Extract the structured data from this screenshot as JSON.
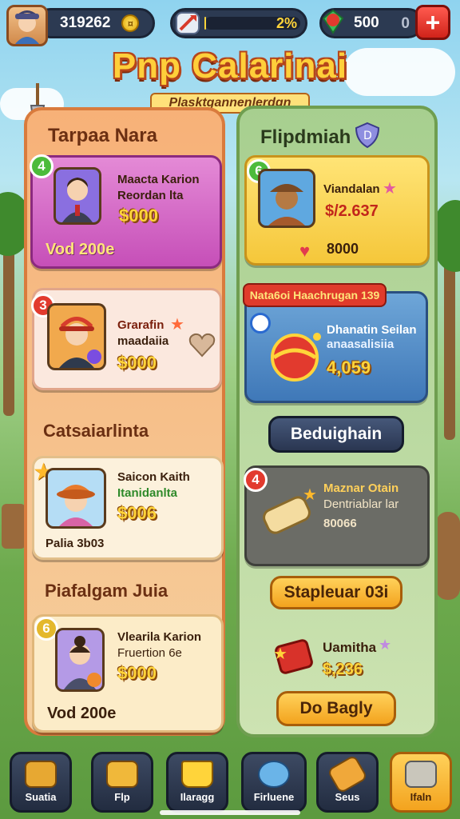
{
  "header": {
    "player_score": "319262",
    "progress_label": "2%",
    "gems": "500",
    "gems_side": "0"
  },
  "title": {
    "main": "Pnp Calarinai",
    "subtitle": "Plasktgannenlerdgn"
  },
  "left_panel": {
    "heading": "Tarpaa Nara",
    "cards": [
      {
        "badge": "4",
        "line1": "Maacta Karion",
        "line2": "Reordan lta",
        "price": "$000",
        "footer": "Vod 200e"
      },
      {
        "badge": "3",
        "line1": "Grarafin",
        "line2": "maadaiia",
        "price": "$000"
      }
    ],
    "section2_heading": "Catsaiarlinta",
    "card3": {
      "line1": "Saicon Kaith",
      "line2": "Itanidanlta",
      "price": "$006",
      "footer": "Palia 3b03"
    },
    "section3_heading": "Piafalgam Juia",
    "card4": {
      "badge": "6",
      "line1": "Vlearila Karion",
      "line2": "Fruertion 6e",
      "price": "$000",
      "footer": "Vod 200e"
    }
  },
  "right_panel": {
    "heading": "Flipdmiah",
    "card1": {
      "badge": "6",
      "line1": "Viandalan",
      "price": "$/2.637",
      "footer": "8000"
    },
    "banner": "Nata6oi Haachrugan 139",
    "card2": {
      "line1": "Dhanatin Seilan",
      "line2": "anaasalisiia",
      "price": "4,059"
    },
    "action_button": "Beduighain",
    "card3": {
      "badge": "4",
      "line1": "Maznar Otain",
      "line2": "Dentriablar lar",
      "price": "80066"
    },
    "button2": "Stapleuar 03i",
    "item": {
      "line1": "Uamitha",
      "price": "$,236"
    },
    "button3": "Do Bagly"
  },
  "nav": [
    {
      "label": "Suatia",
      "icon": "chest-icon"
    },
    {
      "label": "Flp",
      "icon": "treasure-icon"
    },
    {
      "label": "Ilaragg",
      "icon": "crown-icon"
    },
    {
      "label": "Firluene",
      "icon": "fish-icon"
    },
    {
      "label": "Seus",
      "icon": "sword-icon"
    },
    {
      "label": "Ifaln",
      "icon": "robot-icon"
    }
  ],
  "colors": {
    "accent_gold": "#ffd43a",
    "panel_left": "#f5cf9d",
    "panel_right": "#cde3b2",
    "danger": "#e23a2e"
  }
}
